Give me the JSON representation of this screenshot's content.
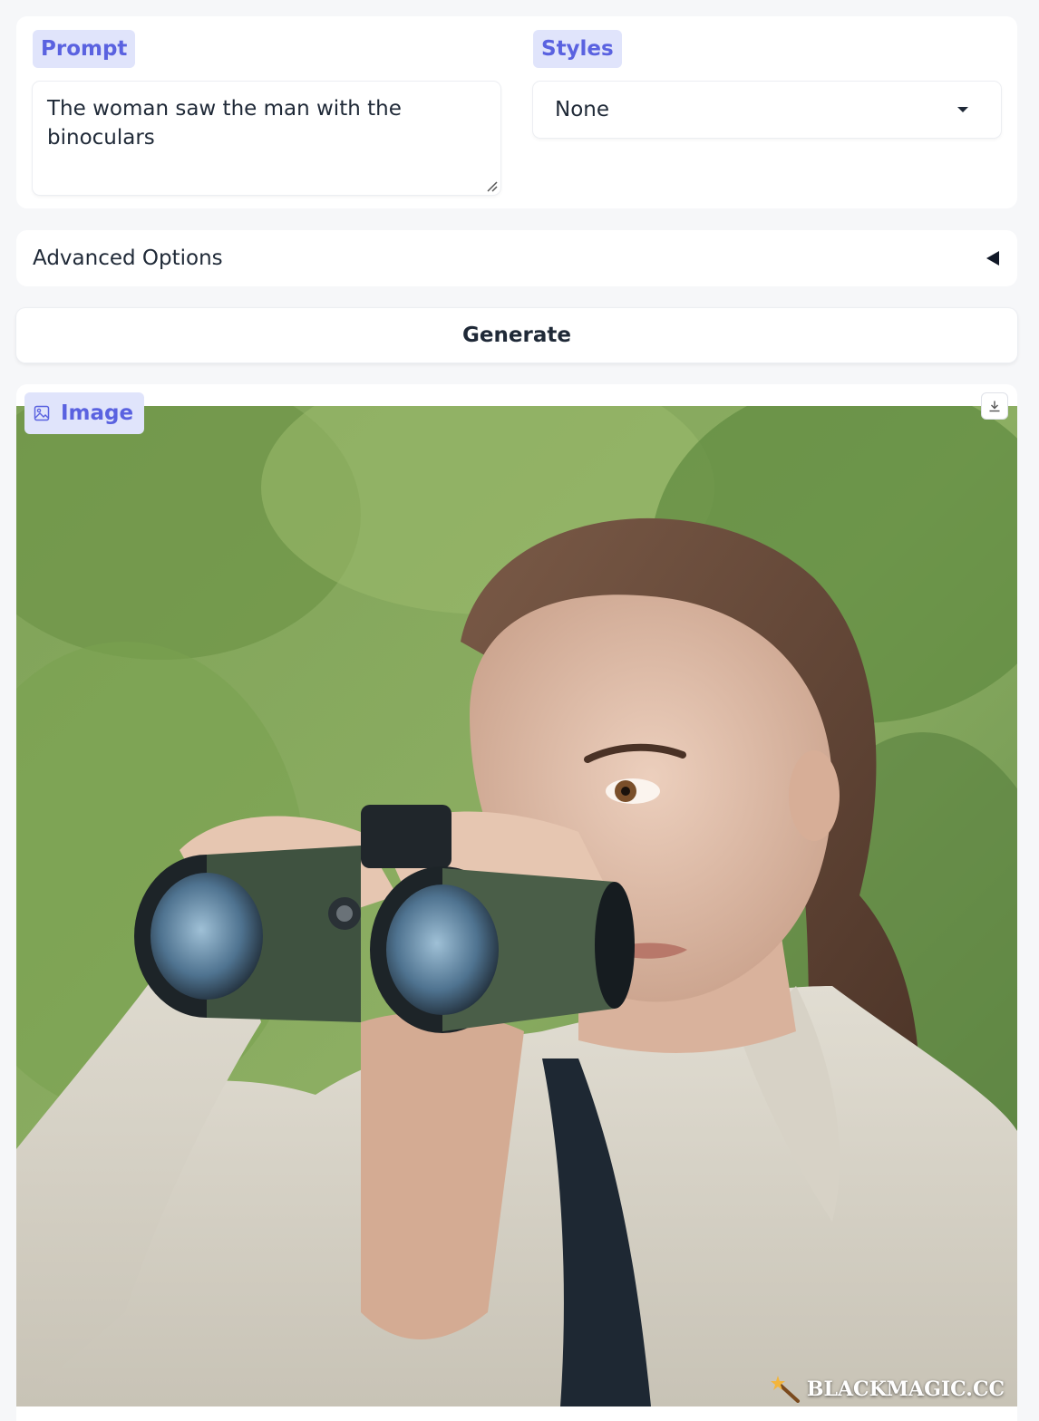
{
  "prompt": {
    "label": "Prompt",
    "value": "The woman saw the man with the binoculars"
  },
  "styles": {
    "label": "Styles",
    "selected": "None"
  },
  "advanced": {
    "label": "Advanced Options"
  },
  "generate": {
    "label": "Generate"
  },
  "output": {
    "label": "Image",
    "watermark": "BLACKMAGIC.CC"
  },
  "colors": {
    "accent": "#5a62e0",
    "chip_bg": "#e0e4fb",
    "page_bg": "#f6f7f9"
  },
  "icons": {
    "image_label": "image-icon",
    "download": "download-icon",
    "dropdown": "chevron-down-icon",
    "accordion": "triangle-left-icon",
    "watermark": "magic-wand-icon"
  }
}
